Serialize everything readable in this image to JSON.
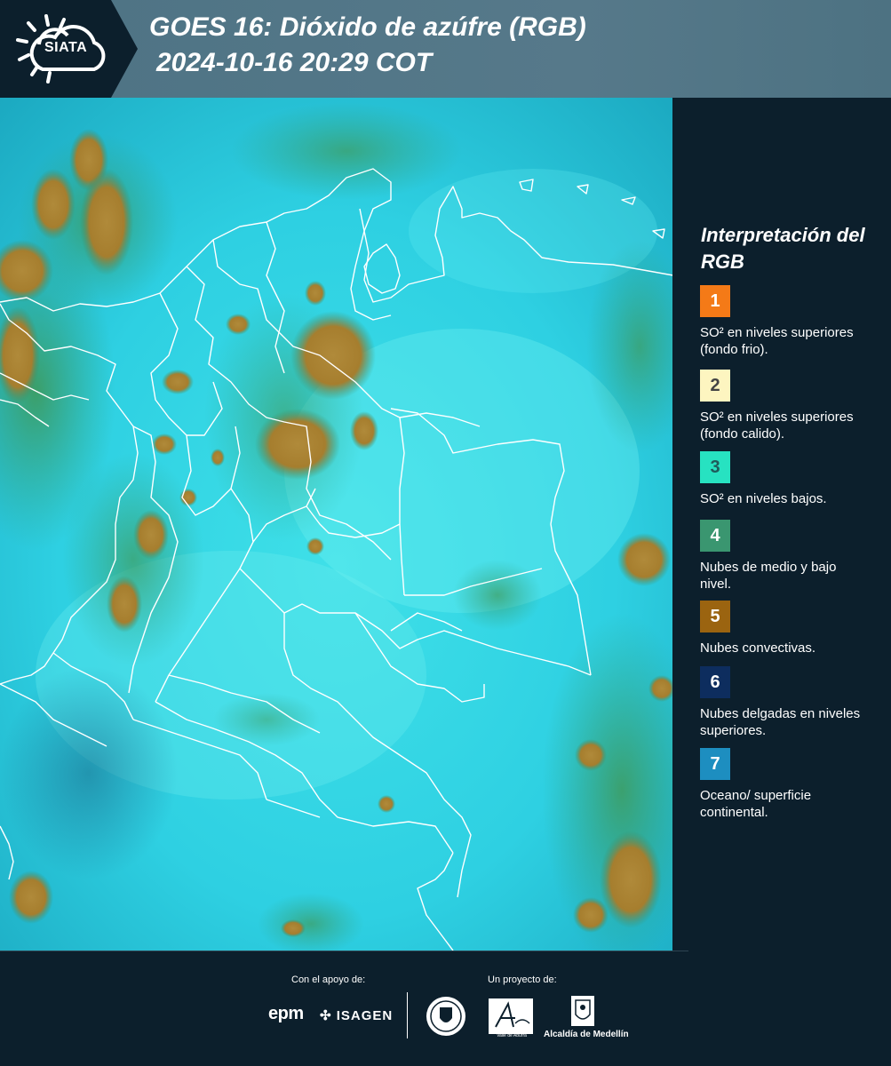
{
  "header": {
    "logo_text": "SIATA",
    "title_line1": "GOES 16: Dióxido de azúfre (RGB)",
    "title_line2": "2024-10-16 20:29 COT"
  },
  "legend": {
    "title": "Interpretación del RGB",
    "items": [
      {
        "number": "1",
        "label": "SO² en niveles superiores (fondo frio).",
        "color": "#f47a17",
        "text_color": "#ffffff"
      },
      {
        "number": "2",
        "label": "SO² en niveles superiores (fondo calido).",
        "color": "#fdf5c0",
        "text_color": "#444444"
      },
      {
        "number": "3",
        "label": "SO² en niveles bajos.",
        "color": "#27e2c1",
        "text_color": "#1f5a5a"
      },
      {
        "number": "4",
        "label": "Nubes de medio y bajo nivel.",
        "color": "#3a9670",
        "text_color": "#ffffff"
      },
      {
        "number": "5",
        "label": "Nubes convectivas.",
        "color": "#9b6410",
        "text_color": "#ffffff"
      },
      {
        "number": "6",
        "label": "Nubes delgadas en niveles superiores.",
        "color": "#0d2d5e",
        "text_color": "#ffffff"
      },
      {
        "number": "7",
        "label": "Oceano/ superficie continental.",
        "color": "#1d8ec0",
        "text_color": "#ffffff"
      }
    ]
  },
  "footer": {
    "support_label": "Con el apoyo de:",
    "project_label": "Un proyecto de:",
    "sponsors": [
      "epm",
      "ISAGEN"
    ],
    "partners": [
      "Área Metropolitana Valle de Aburrá",
      "Alcaldía de Medellín"
    ],
    "area_logo_text": "METROPOLITANA Valle de Aburrá",
    "alcaldia_text": "Alcaldía de Medellín"
  }
}
